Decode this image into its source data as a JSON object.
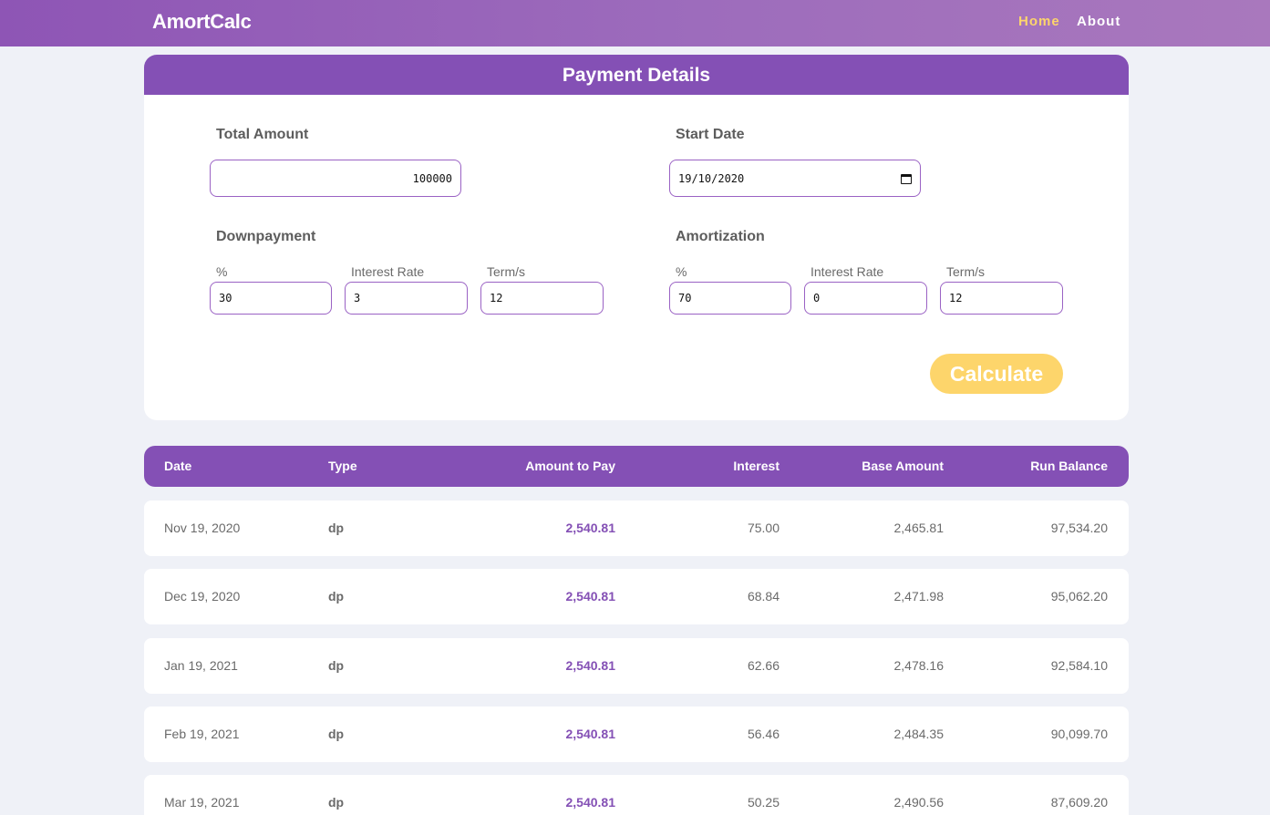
{
  "nav": {
    "brand": "AmortCalc",
    "home": "Home",
    "about": "About"
  },
  "form": {
    "title": "Payment Details",
    "total_amount_label": "Total Amount",
    "total_amount_value": "100000",
    "start_date_label": "Start Date",
    "start_date_value": "19/10/2020",
    "downpayment_label": "Downpayment",
    "amortization_label": "Amortization",
    "downpayment": {
      "percent_label": "%",
      "percent_value": "30",
      "rate_label": "Interest Rate",
      "rate_value": "3",
      "terms_label": "Term/s",
      "terms_value": "12"
    },
    "amortization": {
      "percent_label": "%",
      "percent_value": "70",
      "rate_label": "Interest Rate",
      "rate_value": "0",
      "terms_label": "Term/s",
      "terms_value": "12"
    },
    "calculate_label": "Calculate",
    "calendar_icon": "calendar-icon"
  },
  "table": {
    "headers": {
      "date": "Date",
      "type": "Type",
      "amount": "Amount to Pay",
      "interest": "Interest",
      "base": "Base Amount",
      "balance": "Run Balance"
    },
    "rows": [
      {
        "date": "Nov 19, 2020",
        "type": "dp",
        "amount": "2,540.81",
        "interest": "75.00",
        "base": "2,465.81",
        "balance": "97,534.20"
      },
      {
        "date": "Dec 19, 2020",
        "type": "dp",
        "amount": "2,540.81",
        "interest": "68.84",
        "base": "2,471.98",
        "balance": "95,062.20"
      },
      {
        "date": "Jan 19, 2021",
        "type": "dp",
        "amount": "2,540.81",
        "interest": "62.66",
        "base": "2,478.16",
        "balance": "92,584.10"
      },
      {
        "date": "Feb 19, 2021",
        "type": "dp",
        "amount": "2,540.81",
        "interest": "56.46",
        "base": "2,484.35",
        "balance": "90,099.70"
      },
      {
        "date": "Mar 19, 2021",
        "type": "dp",
        "amount": "2,540.81",
        "interest": "50.25",
        "base": "2,490.56",
        "balance": "87,609.20"
      }
    ]
  },
  "colors": {
    "accent": "#8450b5",
    "button": "#fdd56b",
    "background": "#eff1f7"
  }
}
